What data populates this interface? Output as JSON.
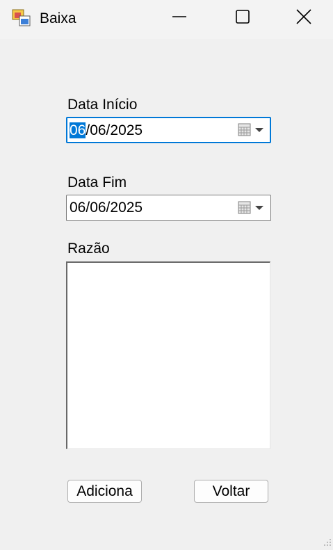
{
  "window": {
    "title": "Baixa"
  },
  "form": {
    "start_label": "Data Início",
    "start_date_day": "06",
    "start_date_rest": "/06/2025",
    "end_label": "Data Fim",
    "end_date": "06/06/2025",
    "reason_label": "Razão",
    "reason_value": ""
  },
  "buttons": {
    "add_label": "Adiciona",
    "back_label": "Voltar"
  },
  "icons": {
    "app": "windows-form-icon",
    "calendar": "calendar-icon",
    "dropdown": "chevron-down-icon",
    "minimize": "minimize-icon",
    "maximize": "maximize-icon",
    "close": "close-icon",
    "grip": "size-grip-icon"
  },
  "colors": {
    "accent": "#0078d7",
    "background": "#f0f0f0",
    "titlebar": "#f3f3f3"
  }
}
